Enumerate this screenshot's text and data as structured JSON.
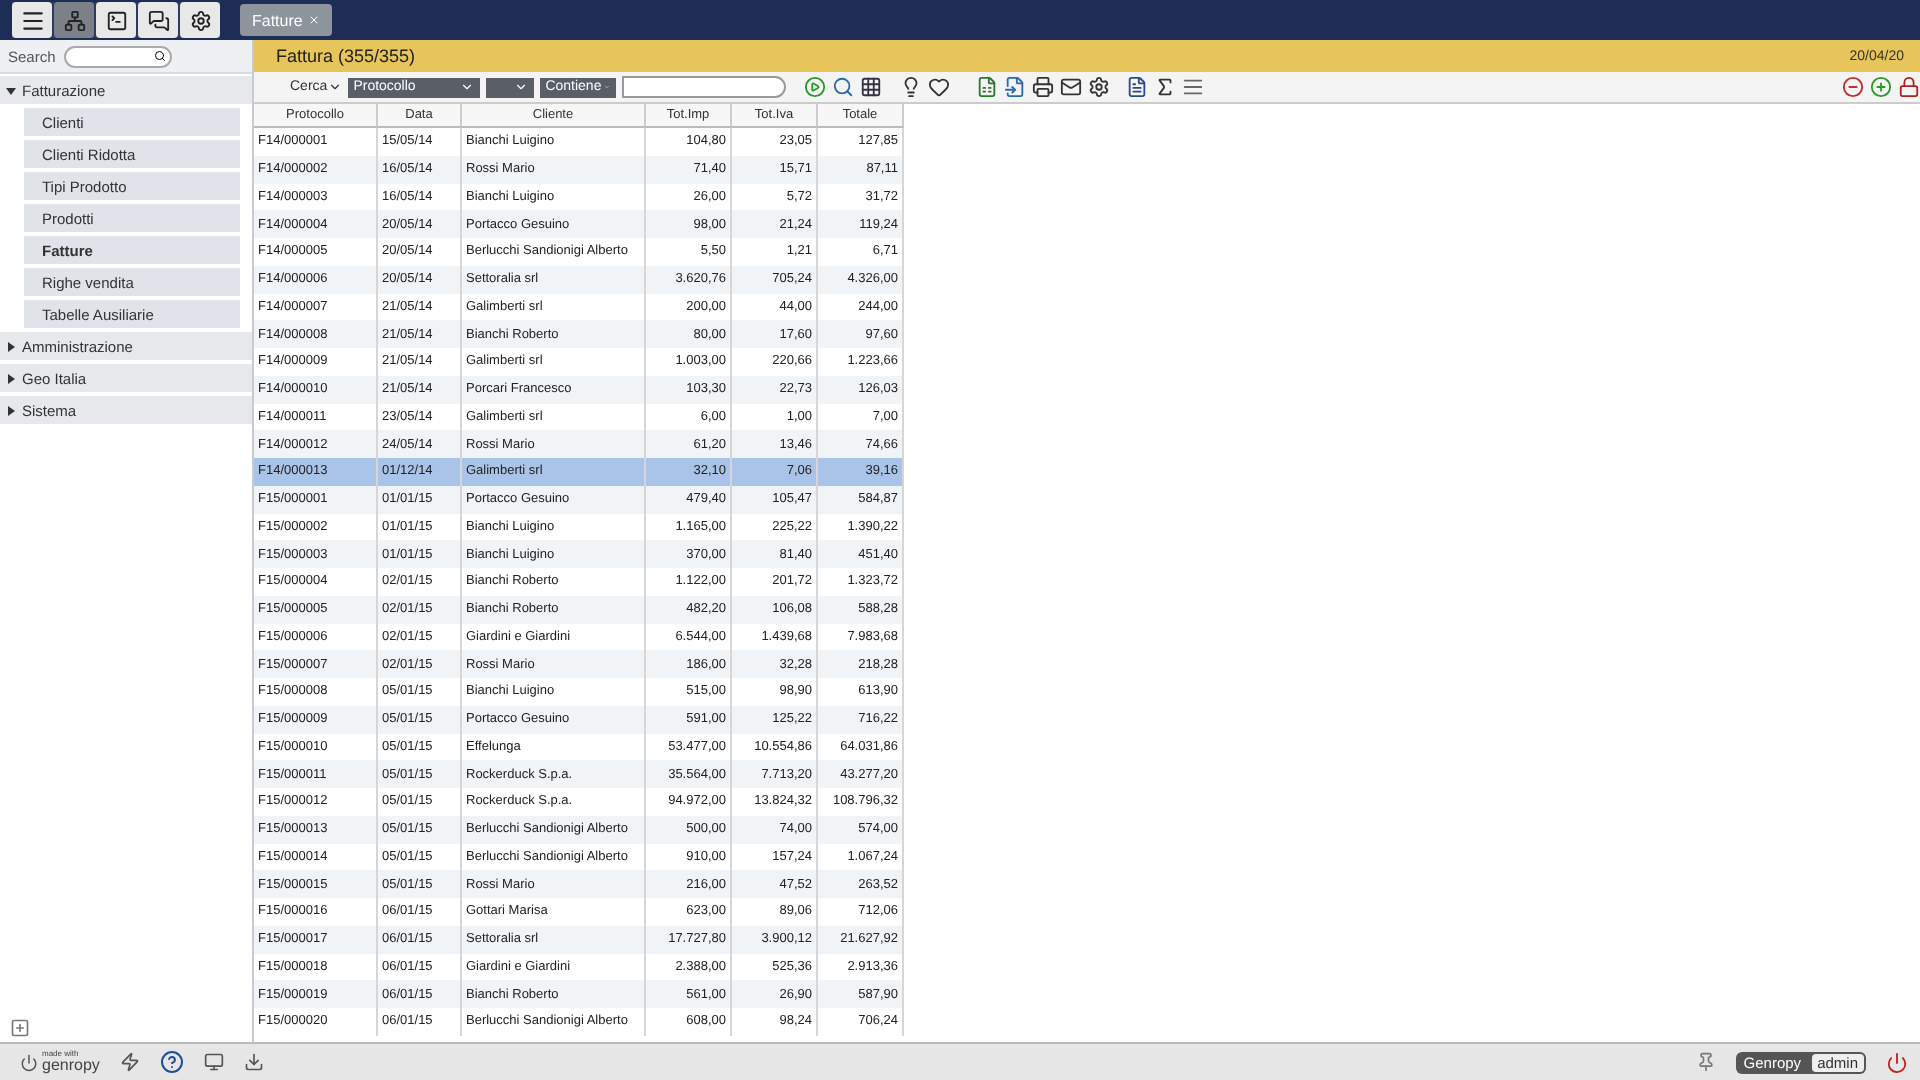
{
  "top_bar": {
    "tabs": [
      {
        "label": "Fatture",
        "selected": true
      }
    ]
  },
  "sidebar": {
    "search": {
      "label": "Search"
    },
    "tree": [
      {
        "label": "Fatturazione",
        "expanded": true,
        "children": [
          {
            "label": "Clienti",
            "selected": false
          },
          {
            "label": "Clienti Ridotta",
            "selected": false
          },
          {
            "label": "Tipi Prodotto",
            "selected": false
          },
          {
            "label": "Prodotti",
            "selected": false
          },
          {
            "label": "Fatture",
            "selected": true
          },
          {
            "label": "Righe vendita",
            "selected": false
          },
          {
            "label": "Tabelle Ausiliarie",
            "selected": false
          }
        ]
      },
      {
        "label": "Amministrazione",
        "expanded": false
      },
      {
        "label": "Geo Italia",
        "expanded": false
      },
      {
        "label": "Sistema",
        "expanded": false
      }
    ]
  },
  "header": {
    "title": "Fattura (355/355)",
    "date": "20/04/20"
  },
  "query_bar": {
    "search_label": "Cerca",
    "field": "Protocollo",
    "operator": "Contiene"
  },
  "table": {
    "columns": [
      "Protocollo",
      "Data",
      "Cliente",
      "Tot.Imp",
      "Tot.Iva",
      "Totale"
    ],
    "rows": [
      {
        "cells": [
          "F14/000001",
          "15/05/14",
          "Bianchi Luigino",
          "104,80",
          "23,05",
          "127,85"
        ],
        "selected": false
      },
      {
        "cells": [
          "F14/000002",
          "16/05/14",
          "Rossi Mario",
          "71,40",
          "15,71",
          "87,11"
        ],
        "selected": false
      },
      {
        "cells": [
          "F14/000003",
          "16/05/14",
          "Bianchi Luigino",
          "26,00",
          "5,72",
          "31,72"
        ],
        "selected": false
      },
      {
        "cells": [
          "F14/000004",
          "20/05/14",
          "Portacco Gesuino",
          "98,00",
          "21,24",
          "119,24"
        ],
        "selected": false
      },
      {
        "cells": [
          "F14/000005",
          "20/05/14",
          "Berlucchi Sandionigi Alberto",
          "5,50",
          "1,21",
          "6,71"
        ],
        "selected": false
      },
      {
        "cells": [
          "F14/000006",
          "20/05/14",
          "Settoralia srl",
          "3.620,76",
          "705,24",
          "4.326,00"
        ],
        "selected": false
      },
      {
        "cells": [
          "F14/000007",
          "21/05/14",
          "Galimberti srl",
          "200,00",
          "44,00",
          "244,00"
        ],
        "selected": false
      },
      {
        "cells": [
          "F14/000008",
          "21/05/14",
          "Bianchi Roberto",
          "80,00",
          "17,60",
          "97,60"
        ],
        "selected": false
      },
      {
        "cells": [
          "F14/000009",
          "21/05/14",
          "Galimberti srl",
          "1.003,00",
          "220,66",
          "1.223,66"
        ],
        "selected": false
      },
      {
        "cells": [
          "F14/000010",
          "21/05/14",
          "Porcari Francesco",
          "103,30",
          "22,73",
          "126,03"
        ],
        "selected": false
      },
      {
        "cells": [
          "F14/000011",
          "23/05/14",
          "Galimberti srl",
          "6,00",
          "1,00",
          "7,00"
        ],
        "selected": false
      },
      {
        "cells": [
          "F14/000012",
          "24/05/14",
          "Rossi Mario",
          "61,20",
          "13,46",
          "74,66"
        ],
        "selected": false
      },
      {
        "cells": [
          "F14/000013",
          "01/12/14",
          "Galimberti srl",
          "32,10",
          "7,06",
          "39,16"
        ],
        "selected": true
      },
      {
        "cells": [
          "F15/000001",
          "01/01/15",
          "Portacco Gesuino",
          "479,40",
          "105,47",
          "584,87"
        ],
        "selected": false
      },
      {
        "cells": [
          "F15/000002",
          "01/01/15",
          "Bianchi Luigino",
          "1.165,00",
          "225,22",
          "1.390,22"
        ],
        "selected": false
      },
      {
        "cells": [
          "F15/000003",
          "01/01/15",
          "Bianchi Luigino",
          "370,00",
          "81,40",
          "451,40"
        ],
        "selected": false
      },
      {
        "cells": [
          "F15/000004",
          "02/01/15",
          "Bianchi Roberto",
          "1.122,00",
          "201,72",
          "1.323,72"
        ],
        "selected": false
      },
      {
        "cells": [
          "F15/000005",
          "02/01/15",
          "Bianchi Roberto",
          "482,20",
          "106,08",
          "588,28"
        ],
        "selected": false
      },
      {
        "cells": [
          "F15/000006",
          "02/01/15",
          "Giardini e Giardini",
          "6.544,00",
          "1.439,68",
          "7.983,68"
        ],
        "selected": false
      },
      {
        "cells": [
          "F15/000007",
          "02/01/15",
          "Rossi Mario",
          "186,00",
          "32,28",
          "218,28"
        ],
        "selected": false
      },
      {
        "cells": [
          "F15/000008",
          "05/01/15",
          "Bianchi Luigino",
          "515,00",
          "98,90",
          "613,90"
        ],
        "selected": false
      },
      {
        "cells": [
          "F15/000009",
          "05/01/15",
          "Portacco Gesuino",
          "591,00",
          "125,22",
          "716,22"
        ],
        "selected": false
      },
      {
        "cells": [
          "F15/000010",
          "05/01/15",
          "Effelunga",
          "53.477,00",
          "10.554,86",
          "64.031,86"
        ],
        "selected": false
      },
      {
        "cells": [
          "F15/000011",
          "05/01/15",
          "Rockerduck S.p.a.",
          "35.564,00",
          "7.713,20",
          "43.277,20"
        ],
        "selected": false
      },
      {
        "cells": [
          "F15/000012",
          "05/01/15",
          "Rockerduck S.p.a.",
          "94.972,00",
          "13.824,32",
          "108.796,32"
        ],
        "selected": false
      },
      {
        "cells": [
          "F15/000013",
          "05/01/15",
          "Berlucchi Sandionigi Alberto",
          "500,00",
          "74,00",
          "574,00"
        ],
        "selected": false
      },
      {
        "cells": [
          "F15/000014",
          "05/01/15",
          "Berlucchi Sandionigi Alberto",
          "910,00",
          "157,24",
          "1.067,24"
        ],
        "selected": false
      },
      {
        "cells": [
          "F15/000015",
          "05/01/15",
          "Rossi Mario",
          "216,00",
          "47,52",
          "263,52"
        ],
        "selected": false
      },
      {
        "cells": [
          "F15/000016",
          "06/01/15",
          "Gottari Marisa",
          "623,00",
          "89,06",
          "712,06"
        ],
        "selected": false
      },
      {
        "cells": [
          "F15/000017",
          "06/01/15",
          "Settoralia srl",
          "17.727,80",
          "3.900,12",
          "21.627,92"
        ],
        "selected": false
      },
      {
        "cells": [
          "F15/000018",
          "06/01/15",
          "Giardini e Giardini",
          "2.388,00",
          "525,36",
          "2.913,36"
        ],
        "selected": false
      },
      {
        "cells": [
          "F15/000019",
          "06/01/15",
          "Bianchi Roberto",
          "561,00",
          "26,90",
          "587,90"
        ],
        "selected": false
      },
      {
        "cells": [
          "F15/000020",
          "06/01/15",
          "Berlucchi Sandionigi Alberto",
          "608,00",
          "98,24",
          "706,24"
        ],
        "selected": false
      }
    ]
  },
  "footer": {
    "logo_small": "made with",
    "logo": "genropy",
    "user_group": "Genropy",
    "user": "admin"
  }
}
